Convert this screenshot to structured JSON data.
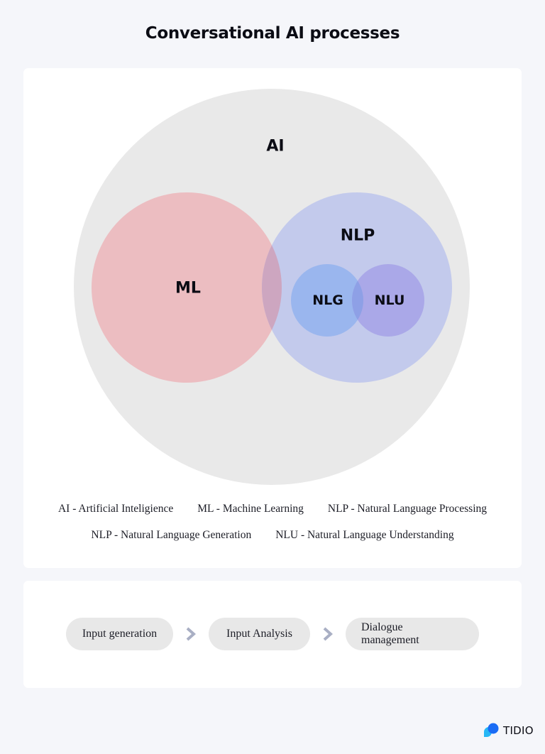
{
  "title": "Conversational AI processes",
  "diagram": {
    "circles": [
      {
        "id": "ai",
        "label": "AI",
        "color": "#e9e9e9",
        "parent": null
      },
      {
        "id": "ml",
        "label": "ML",
        "color": "#ecbdc1",
        "parent": "ai"
      },
      {
        "id": "nlp",
        "label": "NLP",
        "color": "#c3caec",
        "parent": "ai",
        "overlaps": [
          "ml"
        ]
      },
      {
        "id": "nlg",
        "label": "NLG",
        "color": "#9ab6ee",
        "parent": "nlp"
      },
      {
        "id": "nlu",
        "label": "NLU",
        "color": "#aaa8e8",
        "parent": "nlp",
        "overlaps": [
          "nlg"
        ]
      }
    ],
    "overlap_colors": {
      "ml_nlp": "#cda6c0",
      "nlg_nlu": "#8ea0e6"
    }
  },
  "legend": {
    "row1": [
      "AI - Artificial Inteligience",
      "ML - Machine Learning",
      "NLP - Natural Language Processing"
    ],
    "row2": [
      "NLP - Natural Language Generation",
      "NLU - Natural Language Understanding"
    ]
  },
  "flow": {
    "steps": [
      "Input generation",
      "Input Analysis",
      "Dialogue management"
    ],
    "arrow_icon": "chevron-right-icon",
    "arrow_color": "#a9afc4",
    "pill_color": "#e8e8e8"
  },
  "brand": {
    "name": "TIDIO",
    "icon": "tidio-logo-icon",
    "colors": [
      "#1a6cf5",
      "#27b7f5"
    ]
  }
}
